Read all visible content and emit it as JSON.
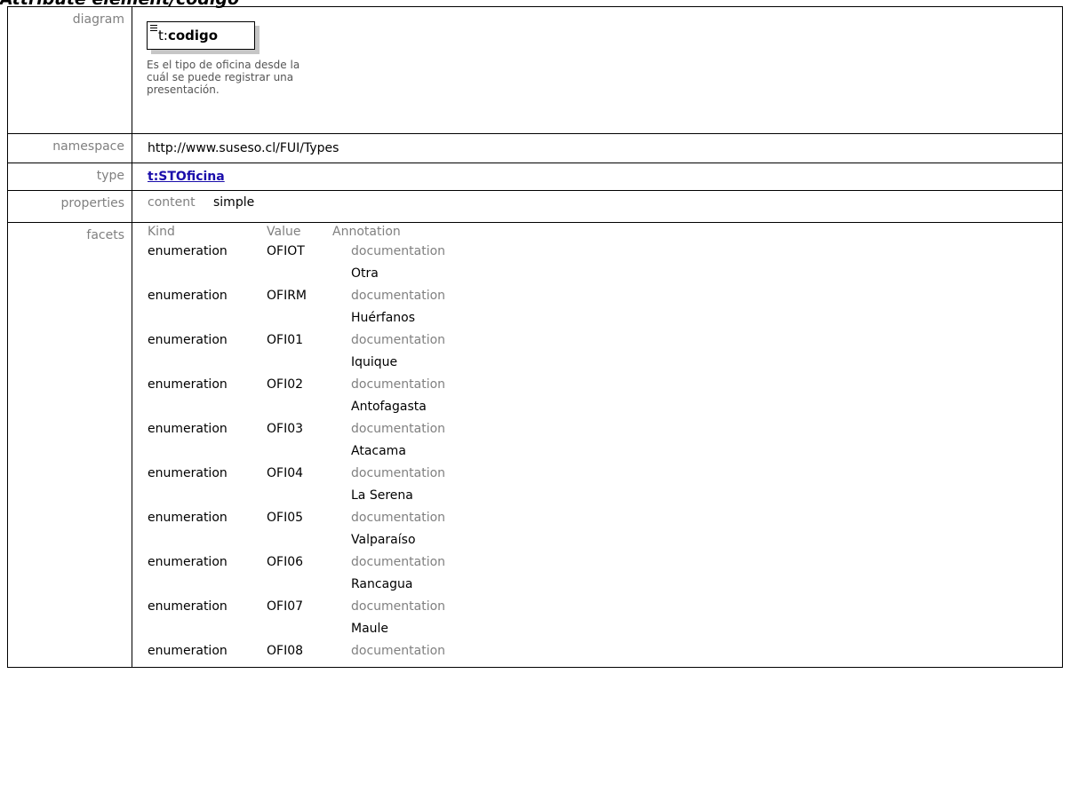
{
  "heading": "Attribute element/codigo",
  "rows": {
    "diagram_label": "diagram",
    "namespace_label": "namespace",
    "type_label": "type",
    "properties_label": "properties",
    "facets_label": "facets"
  },
  "diagram": {
    "prefix": "t:",
    "name": "codigo",
    "documentation_lines": [
      "Es el tipo de oficina desde la",
      "cuál se puede registrar una",
      "presentación."
    ]
  },
  "namespace": "http://www.suseso.cl/FUI/Types",
  "type_link": "t:STOficina",
  "properties": {
    "key": "content",
    "value": "simple"
  },
  "facets": {
    "headers": {
      "kind": "Kind",
      "value": "Value",
      "annotation": "Annotation"
    },
    "items": [
      {
        "kind": "enumeration",
        "value": "OFIOT",
        "annotation": "documentation",
        "doc": "Otra"
      },
      {
        "kind": "enumeration",
        "value": "OFIRM",
        "annotation": "documentation",
        "doc": "Huérfanos"
      },
      {
        "kind": "enumeration",
        "value": "OFI01",
        "annotation": "documentation",
        "doc": "Iquique"
      },
      {
        "kind": "enumeration",
        "value": "OFI02",
        "annotation": "documentation",
        "doc": "Antofagasta"
      },
      {
        "kind": "enumeration",
        "value": "OFI03",
        "annotation": "documentation",
        "doc": "Atacama"
      },
      {
        "kind": "enumeration",
        "value": "OFI04",
        "annotation": "documentation",
        "doc": "La Serena"
      },
      {
        "kind": "enumeration",
        "value": "OFI05",
        "annotation": "documentation",
        "doc": "Valparaíso"
      },
      {
        "kind": "enumeration",
        "value": "OFI06",
        "annotation": "documentation",
        "doc": "Rancagua"
      },
      {
        "kind": "enumeration",
        "value": "OFI07",
        "annotation": "documentation",
        "doc": "Maule"
      },
      {
        "kind": "enumeration",
        "value": "OFI08",
        "annotation": "documentation",
        "doc": ""
      }
    ]
  }
}
